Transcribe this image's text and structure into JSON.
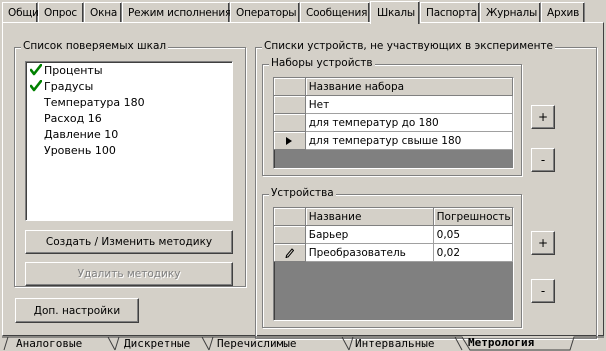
{
  "top_tabs": [
    {
      "label": "Общие"
    },
    {
      "label": "Опрос"
    },
    {
      "label": "Окна"
    },
    {
      "label": "Режим исполнения"
    },
    {
      "label": "Операторы"
    },
    {
      "label": "Сообщения"
    },
    {
      "label": "Шкалы",
      "active": true
    },
    {
      "label": "Паспорта"
    },
    {
      "label": "Журналы"
    },
    {
      "label": "Архив"
    }
  ],
  "scales_group": {
    "legend": "Список поверяемых шкал",
    "items": [
      {
        "label": "Проценты",
        "checked": true
      },
      {
        "label": "Градусы",
        "checked": true
      },
      {
        "label": "Температура 180",
        "checked": false
      },
      {
        "label": "Расход 16",
        "checked": false
      },
      {
        "label": "Давление 10",
        "checked": false
      },
      {
        "label": "Уровень 100",
        "checked": false
      }
    ],
    "create_button": "Создать / Изменить методику",
    "delete_button": "Удалить методику"
  },
  "extra_settings_button": "Доп. настройки",
  "devices_group": {
    "legend": "Списки устройств, не участвующих в эксперименте",
    "sets": {
      "legend": "Наборы устройств",
      "header": "Название набора",
      "rows": [
        {
          "name": "Нет",
          "current": false
        },
        {
          "name": "для температур до 180",
          "current": false
        },
        {
          "name": "для температур свыше 180",
          "current": true
        }
      ],
      "add_label": "+",
      "remove_label": "-"
    },
    "devices": {
      "legend": "Устройства",
      "headers": [
        "Название",
        "Погрешность"
      ],
      "rows": [
        {
          "name": "Барьер",
          "error": "0,05",
          "editing": false
        },
        {
          "name": "Преобразователь",
          "error": "0,02",
          "editing": true
        }
      ],
      "add_label": "+",
      "remove_label": "-"
    }
  },
  "bottom_tabs": [
    {
      "label": "Аналоговые"
    },
    {
      "label": "Дискретные"
    },
    {
      "label": "Перечислимые"
    },
    {
      "label": "Интервальные"
    },
    {
      "label": "Метрология",
      "active": true
    }
  ],
  "colors": {
    "face": "#d4d0c8",
    "check": "#008000",
    "grid_empty": "#808080"
  }
}
